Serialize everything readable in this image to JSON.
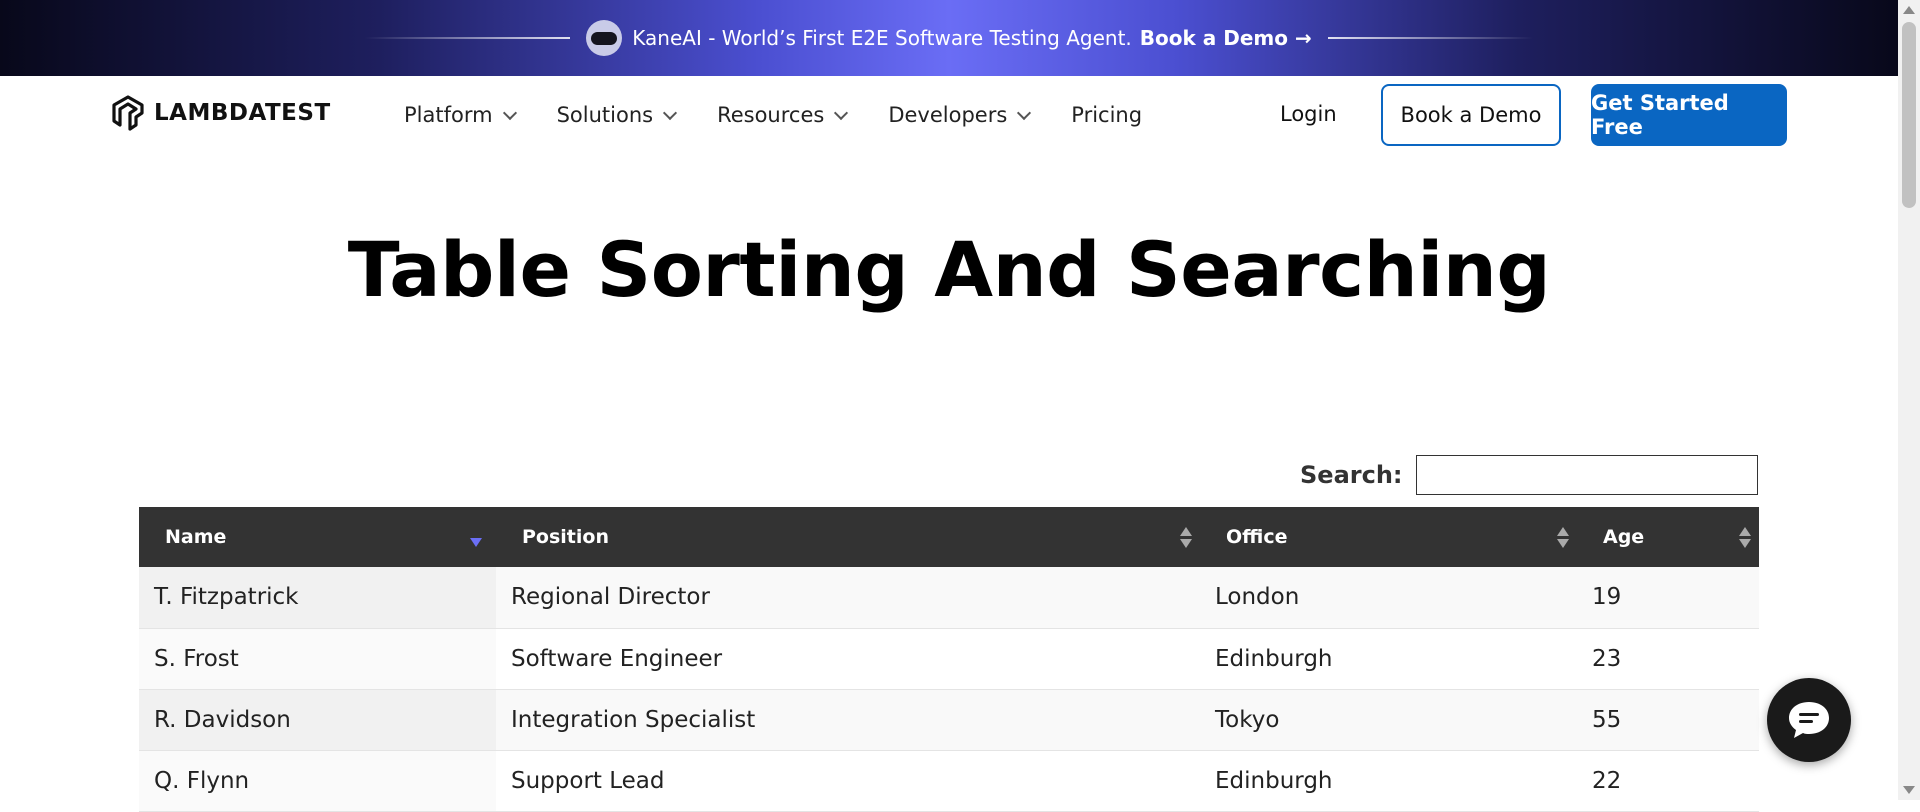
{
  "promo": {
    "text": "KaneAI - World’s First E2E Software Testing Agent.",
    "cta": "Book a Demo →",
    "icon": "kaneai-avatar-icon"
  },
  "nav": {
    "logo_text": "LAMBDATEST",
    "items": [
      {
        "label": "Platform",
        "dropdown": true
      },
      {
        "label": "Solutions",
        "dropdown": true
      },
      {
        "label": "Resources",
        "dropdown": true
      },
      {
        "label": "Developers",
        "dropdown": true
      },
      {
        "label": "Pricing",
        "dropdown": false
      }
    ],
    "login": "Login",
    "book_demo": "Book a Demo",
    "get_started": "Get Started Free"
  },
  "page": {
    "title": "Table Sorting And Searching"
  },
  "search": {
    "label": "Search:",
    "value": ""
  },
  "table": {
    "columns": [
      "Name",
      "Position",
      "Office",
      "Age"
    ],
    "sorted_column": "Name",
    "sort_direction": "descending",
    "rows": [
      [
        "T. Fitzpatrick",
        "Regional Director",
        "London",
        "19"
      ],
      [
        "S. Frost",
        "Software Engineer",
        "Edinburgh",
        "23"
      ],
      [
        "R. Davidson",
        "Integration Specialist",
        "Tokyo",
        "55"
      ],
      [
        "Q. Flynn",
        "Support Lead",
        "Edinburgh",
        "22"
      ]
    ]
  },
  "colors": {
    "brand_blue": "#0a66c2",
    "table_header": "#333333",
    "sort_active": "#6b6ff5"
  },
  "chat": {
    "icon": "chat-bubble-icon"
  }
}
